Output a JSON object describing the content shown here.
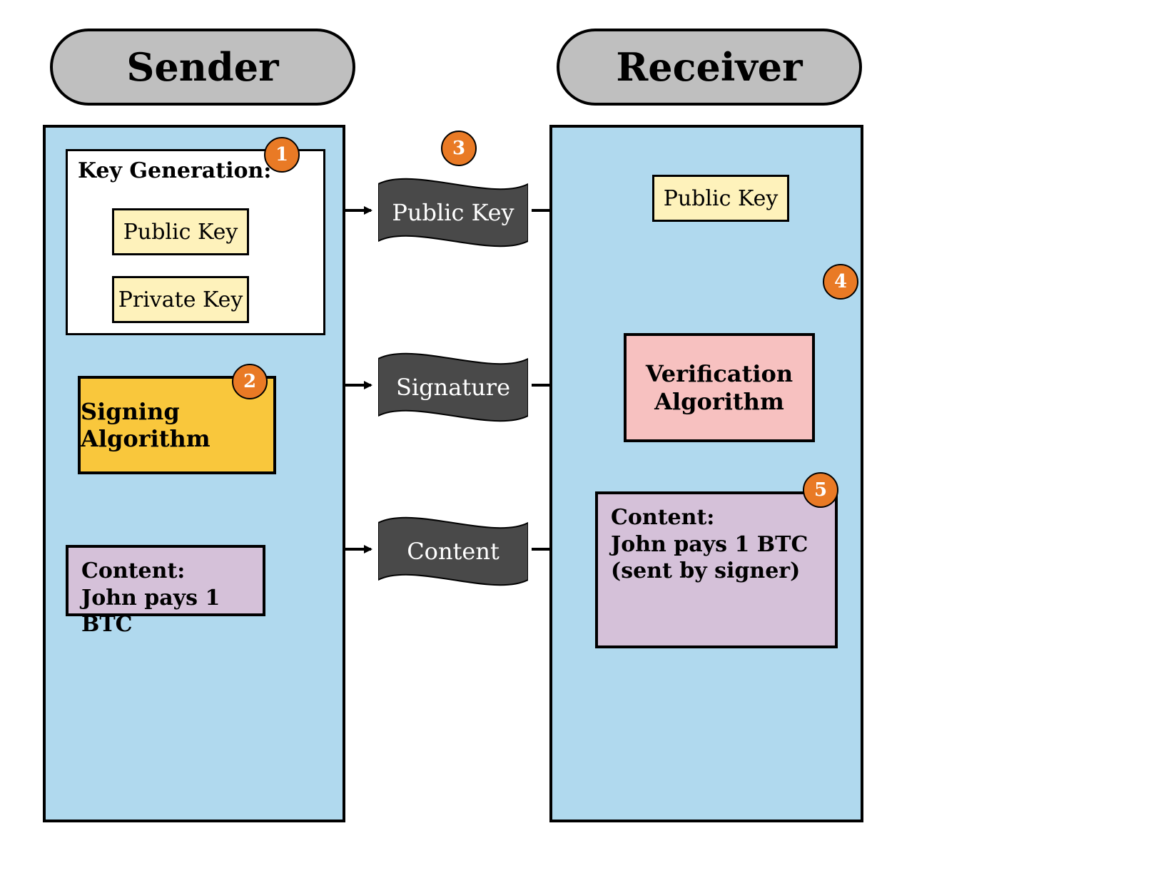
{
  "sender": {
    "title": "Sender",
    "key_generation_label": "Key Generation:",
    "public_key": "Public Key",
    "private_key": "Private Key",
    "signing_algorithm": "Signing Algorithm",
    "content_header": "Content:",
    "content_body": "John pays 1 BTC"
  },
  "receiver": {
    "title": "Receiver",
    "public_key": "Public Key",
    "verification_algorithm": "Verification\nAlgorithm",
    "content_header": "Content:",
    "content_line1": "John pays 1 BTC",
    "content_line2": "(sent by signer)"
  },
  "transit": {
    "public_key": "Public Key",
    "signature": "Signature",
    "content": "Content"
  },
  "badges": {
    "b1": "1",
    "b2": "2",
    "b3": "3",
    "b4": "4",
    "b5": "5"
  }
}
